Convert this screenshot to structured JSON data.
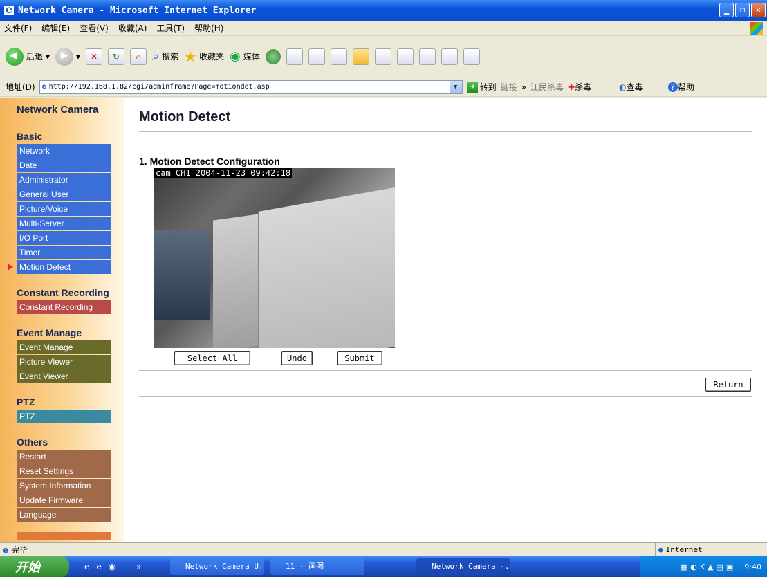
{
  "window": {
    "title": "Network Camera - Microsoft Internet Explorer"
  },
  "menu": [
    "文件(F)",
    "编辑(E)",
    "查看(V)",
    "收藏(A)",
    "工具(T)",
    "帮助(H)"
  ],
  "toolbar": {
    "back": "后退",
    "search": "搜索",
    "favorites": "收藏夹",
    "media": "媒体"
  },
  "address": {
    "label": "地址(D)",
    "url": "http://192.168.1.82/cgi/adminframe?Page=motiondet.asp",
    "go": "转到",
    "links": "链接",
    "chev": "»",
    "jiangmin": "江民杀毒",
    "kill": "杀毒",
    "scan": "查毒",
    "help": "帮助"
  },
  "sidebar": {
    "brand": "Network Camera",
    "basic": {
      "title": "Basic",
      "items": [
        "Network",
        "Date",
        "Administrator",
        "General User",
        "Picture/Voice",
        "Multi-Server",
        "I/O Port",
        "Timer",
        "Motion Detect"
      ]
    },
    "constant": {
      "title": "Constant Recording",
      "items": [
        "Constant Recording"
      ]
    },
    "event": {
      "title": "Event Manage",
      "items": [
        "Event Manage",
        "Picture Viewer",
        "Event Viewer"
      ]
    },
    "ptz": {
      "title": "PTZ",
      "items": [
        "PTZ"
      ]
    },
    "others": {
      "title": "Others",
      "items": [
        "Restart",
        "Reset Settings",
        "System Information",
        "Update Firmware",
        "Language"
      ]
    },
    "active": "Motion Detect"
  },
  "main": {
    "title": "Motion Detect",
    "section": "1. Motion Detect Configuration",
    "camera_overlay": "cam CH1 2004-11-23 09:42:18",
    "buttons": {
      "select_all": "Select All",
      "undo": "Undo",
      "submit": "Submit",
      "return": "Return"
    }
  },
  "status": {
    "text": "完毕",
    "zone": "Internet"
  },
  "taskbar": {
    "start": "开始",
    "chev": "»",
    "tasks": [
      "Network Camera U...",
      "11 - 画图",
      "Network Camera -..."
    ],
    "clock": "9:40"
  }
}
